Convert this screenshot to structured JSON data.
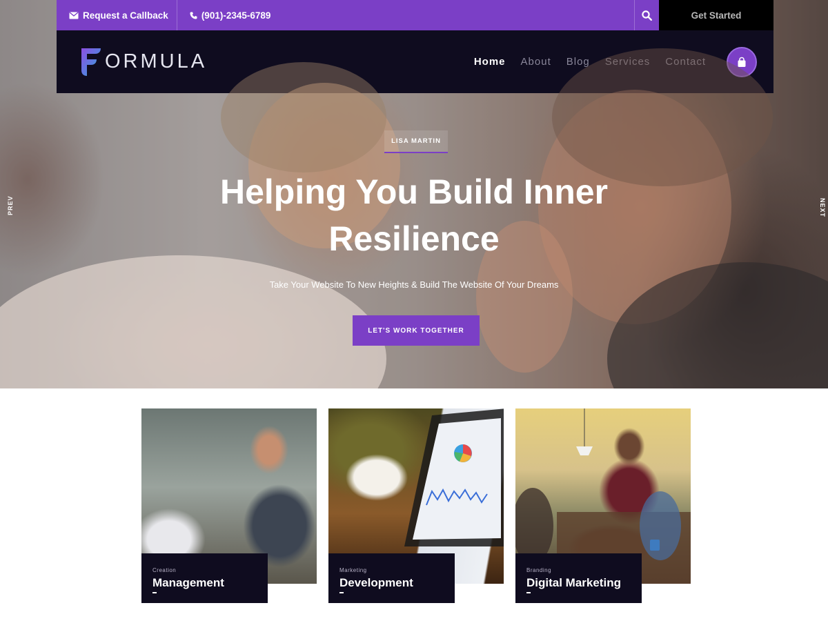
{
  "topbar": {
    "callback_label": "Request a Callback",
    "phone": "(901)-2345-6789",
    "get_started": "Get Started",
    "icons": {
      "mail": "envelope-icon",
      "phone": "phone-icon",
      "search": "search-icon"
    }
  },
  "header": {
    "logo_text": "ORMULA",
    "logo_letter": "F",
    "nav": [
      {
        "label": "Home",
        "active": true
      },
      {
        "label": "About",
        "active": false
      },
      {
        "label": "Blog",
        "active": false
      },
      {
        "label": "Services",
        "active": false
      },
      {
        "label": "Contact",
        "active": false
      }
    ],
    "cart_icon": "shopping-bag-icon"
  },
  "hero": {
    "eyebrow": "LISA MARTIN",
    "title_line1": "Helping You Build Inner",
    "title_line2": "Resilience",
    "subtitle": "Take Your Website To New Heights & Build The Website Of Your Dreams",
    "cta": "LET'S WORK TOGETHER",
    "prev": "PREV",
    "next": "NEXT"
  },
  "cards": [
    {
      "category": "Creation",
      "title": "Management"
    },
    {
      "category": "Marketing",
      "title": "Development"
    },
    {
      "category": "Branding",
      "title": "Digital Marketing"
    }
  ],
  "colors": {
    "accent": "#7b3fc6",
    "dark": "#0f0c1f",
    "black": "#000000",
    "nav_inactive": "#8a879a"
  }
}
